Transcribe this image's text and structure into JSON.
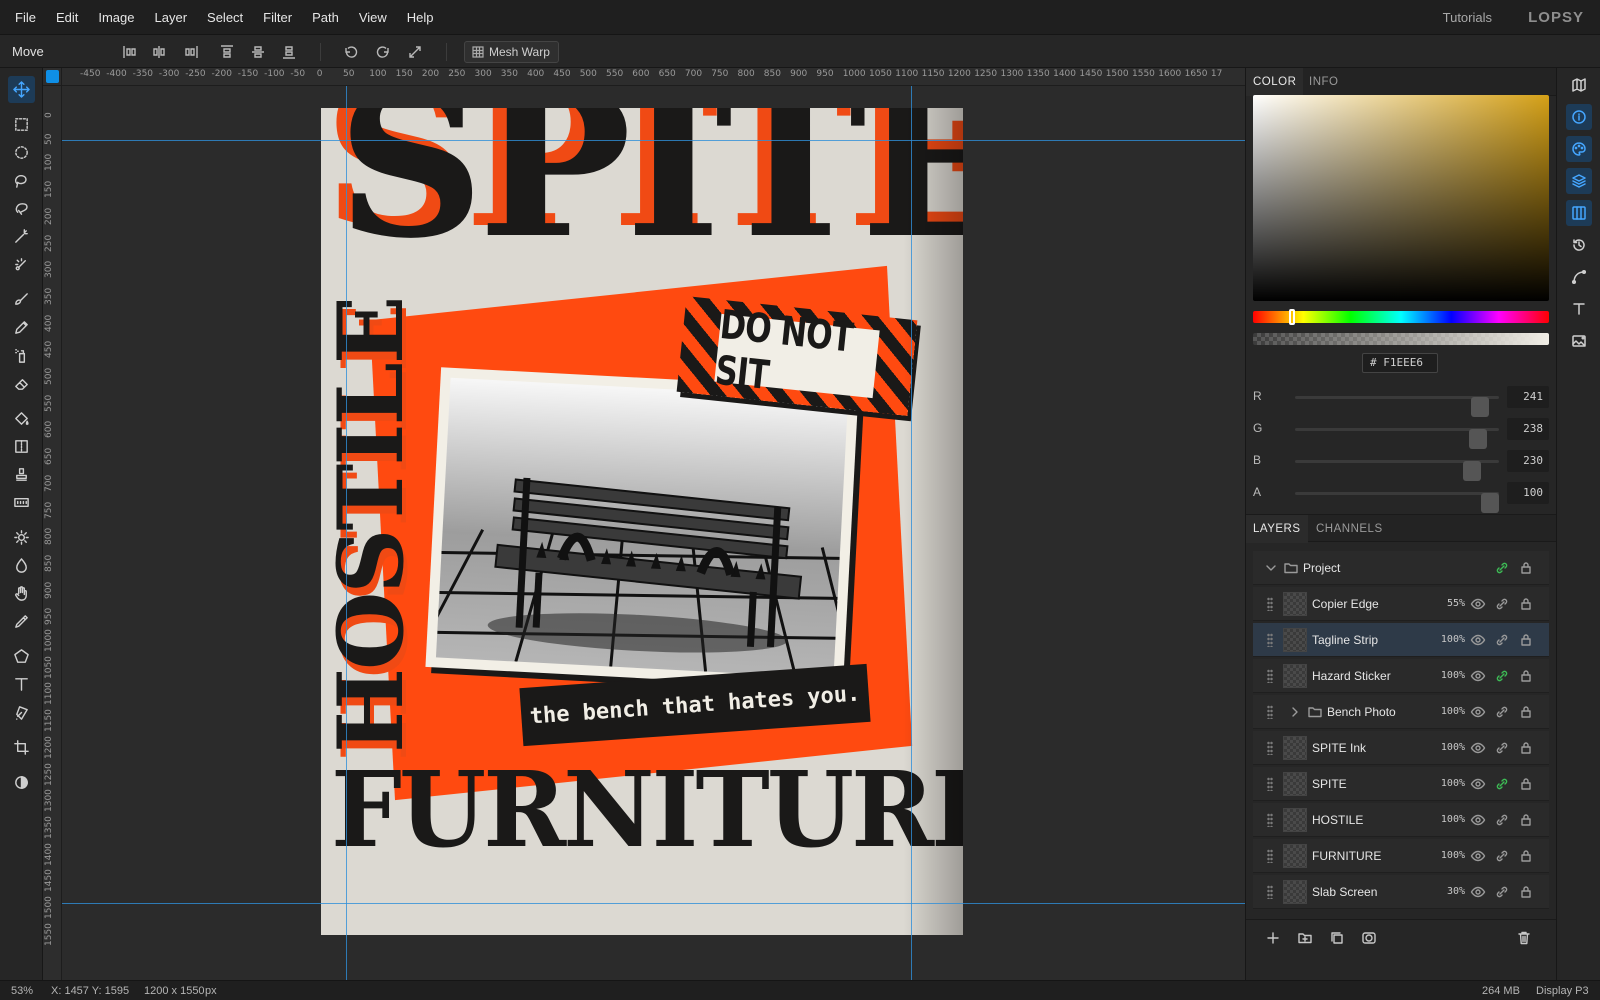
{
  "menubar": {
    "items": [
      "File",
      "Edit",
      "Image",
      "Layer",
      "Select",
      "Filter",
      "Path",
      "View",
      "Help"
    ],
    "tutorials": "Tutorials",
    "logo": "LOPSY"
  },
  "options": {
    "tool_name": "Move",
    "mesh_warp": "Mesh Warp"
  },
  "tools": [
    "move-tool",
    "rect-select-tool",
    "ellipse-select-tool",
    "lasso-tool",
    "magnetic-lasso-tool",
    "magic-wand-tool",
    "quick-select-tool",
    "brush-tool",
    "pencil-tool",
    "clone-tool",
    "eraser-tool",
    "fill-tool",
    "gradient-tool",
    "stamp-tool",
    "text-smart-tool",
    "dodge-tool",
    "blur-tool",
    "hand-tool",
    "eyedropper-tool",
    "shape-tool",
    "type-tool",
    "pen-tool",
    "crop-tool",
    "mask-toggle-tool"
  ],
  "ruler": {
    "h_labels": [
      "-450",
      "-400",
      "-350",
      "-300",
      "-250",
      "-200",
      "-150",
      "-100",
      "-50",
      "0",
      "50",
      "100",
      "150",
      "200",
      "250",
      "300",
      "350",
      "400",
      "450",
      "500",
      "550",
      "600",
      "650",
      "700",
      "750",
      "800",
      "850",
      "900",
      "950",
      "1000",
      "1050",
      "1100",
      "1150",
      "1200",
      "1250",
      "1300",
      "1350",
      "1400",
      "1450",
      "1500",
      "1550",
      "1600",
      "1650",
      "17"
    ],
    "v_labels": [
      "0",
      "50",
      "100",
      "150",
      "200",
      "250",
      "300",
      "350",
      "400",
      "450",
      "500",
      "550",
      "600",
      "650",
      "700",
      "750",
      "800",
      "850",
      "900",
      "950",
      "1000",
      "1050",
      "1100",
      "1150",
      "1200",
      "1250",
      "1300",
      "1350",
      "1400",
      "1450",
      "1500",
      "1550"
    ]
  },
  "artwork": {
    "title_top": "SPITE",
    "title_side": "HOSTILE",
    "title_bottom": "FURNITURE",
    "sticker": "DO NOT SIT",
    "tagline": "the bench that hates you."
  },
  "color_panel": {
    "tabs": [
      "COLOR",
      "INFO"
    ],
    "hex_prefix": "#",
    "hex": "F1EEE6",
    "channels": [
      {
        "label": "R",
        "value": "241",
        "fraction": 0.945
      },
      {
        "label": "G",
        "value": "238",
        "fraction": 0.933
      },
      {
        "label": "B",
        "value": "230",
        "fraction": 0.902
      },
      {
        "label": "A",
        "value": "100",
        "fraction": 1.0
      }
    ]
  },
  "layers_panel": {
    "tabs": [
      "LAYERS",
      "CHANNELS"
    ],
    "group": "Project",
    "layers": [
      {
        "name": "Copier Edge",
        "opacity": "55%",
        "selected": false,
        "linked": false,
        "folder": false
      },
      {
        "name": "Tagline Strip",
        "opacity": "100%",
        "selected": true,
        "linked": false,
        "folder": false
      },
      {
        "name": "Hazard Sticker",
        "opacity": "100%",
        "selected": false,
        "linked": true,
        "folder": false
      },
      {
        "name": "Bench Photo",
        "opacity": "100%",
        "selected": false,
        "linked": false,
        "folder": true
      },
      {
        "name": "SPITE Ink",
        "opacity": "100%",
        "selected": false,
        "linked": false,
        "folder": false
      },
      {
        "name": "SPITE",
        "opacity": "100%",
        "selected": false,
        "linked": true,
        "folder": false
      },
      {
        "name": "HOSTILE",
        "opacity": "100%",
        "selected": false,
        "linked": false,
        "folder": false
      },
      {
        "name": "FURNITURE",
        "opacity": "100%",
        "selected": false,
        "linked": false,
        "folder": false
      },
      {
        "name": "Slab Screen",
        "opacity": "30%",
        "selected": false,
        "linked": false,
        "folder": false
      }
    ]
  },
  "status": {
    "zoom": "53%",
    "cursor": "X: 1457 Y: 1595",
    "doc_size": "1200 x 1550",
    "doc_unit": "px",
    "memory": "264 MB",
    "display": "Display P3"
  }
}
